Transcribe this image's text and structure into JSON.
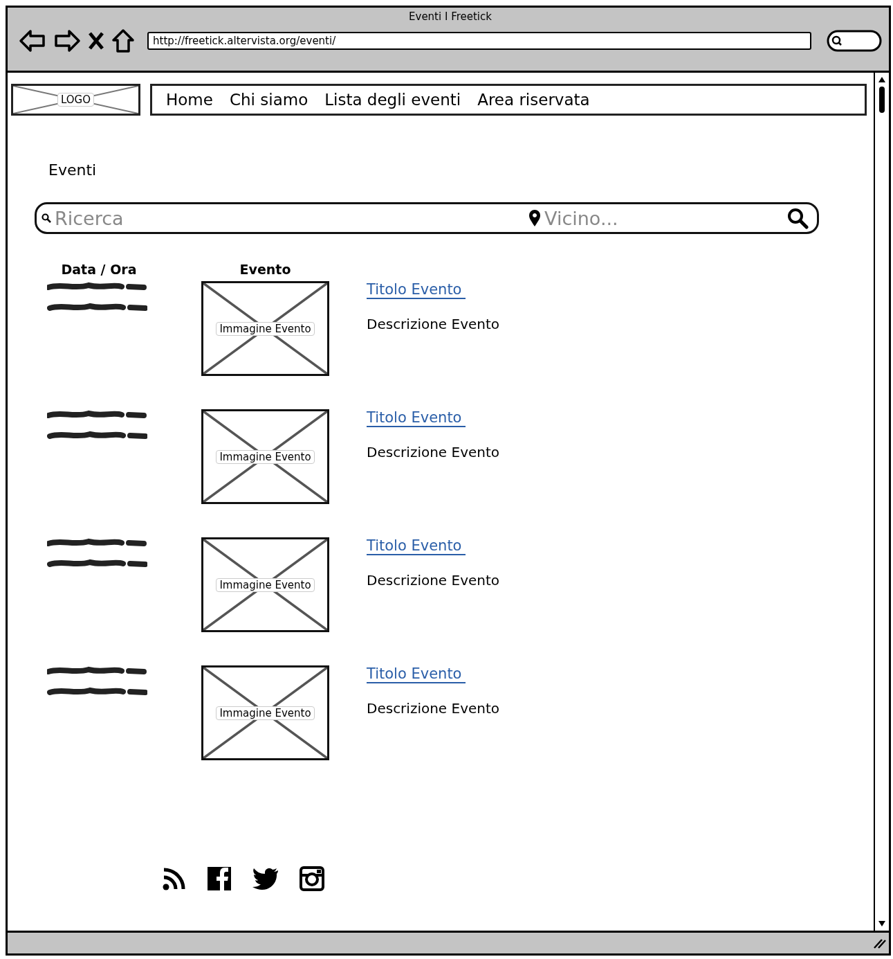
{
  "window": {
    "title": "Eventi I Freetick"
  },
  "address_bar": {
    "url": "http://freetick.altervista.org/eventi/"
  },
  "logo": {
    "label": "LOGO"
  },
  "nav": {
    "items": [
      "Home",
      "Chi siamo",
      "Lista degli eventi",
      "Area riservata"
    ]
  },
  "heading": "Eventi",
  "search": {
    "placeholder": "Ricerca",
    "location_placeholder": "Vicino..."
  },
  "table": {
    "columns": [
      "Data / Ora",
      "Evento"
    ],
    "rows": [
      {
        "image_label": "Immagine Evento",
        "title": "Titolo Evento",
        "description": "Descrizione Evento"
      },
      {
        "image_label": "Immagine Evento",
        "title": "Titolo Evento",
        "description": "Descrizione Evento"
      },
      {
        "image_label": "Immagine Evento",
        "title": "Titolo Evento",
        "description": "Descrizione Evento"
      },
      {
        "image_label": "Immagine Evento",
        "title": "Titolo Evento",
        "description": "Descrizione Evento"
      }
    ]
  }
}
